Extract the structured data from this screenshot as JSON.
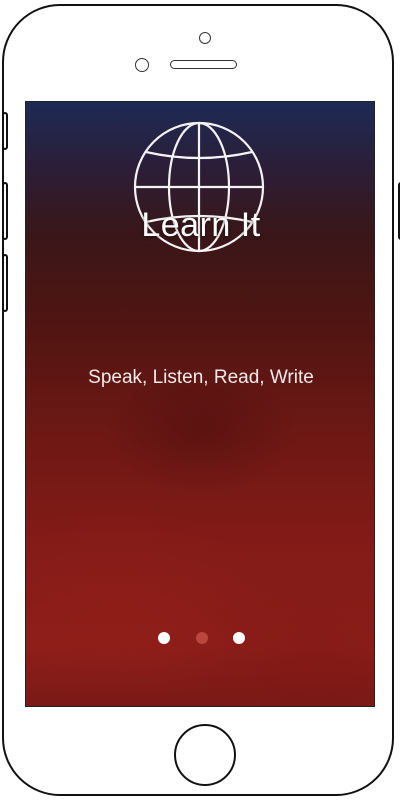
{
  "app": {
    "title": "Learn It",
    "tagline": "Speak, Listen, Read, Write",
    "logo_icon": "globe-icon"
  },
  "pager": {
    "total": 3,
    "active_index": 2
  },
  "colors": {
    "background_top": "#1e2a55",
    "background_bottom": "#8e1e19",
    "text": "#ffffff",
    "dot_active": "#b9463f",
    "dot_inactive": "#ffffff"
  }
}
